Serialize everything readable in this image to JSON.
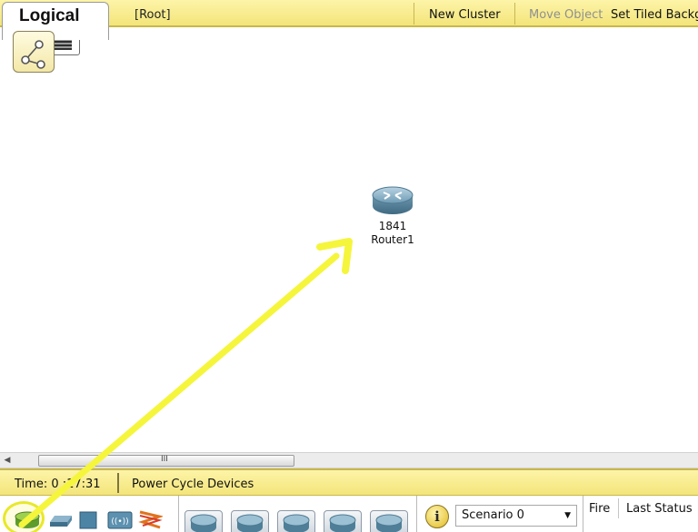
{
  "toolbar": {
    "tab_label": "Logical",
    "path": "[Root]",
    "new_cluster": "New Cluster",
    "move_object": "Move Object",
    "set_tiled_background": "Set Tiled Backg"
  },
  "workspace": {
    "device": {
      "model": "1841",
      "name": "Router1",
      "icon": "router-icon"
    },
    "annotation_color": "#f5f53c"
  },
  "scrollbar": {
    "grip": "III"
  },
  "statusbar": {
    "time": "Time: 0 :17:31",
    "power_cycle": "Power Cycle Devices"
  },
  "bottom_panel": {
    "categories": [
      "routers-icon",
      "switches-icon",
      "hubs-icon",
      "wireless-devices-icon",
      "connections-icon"
    ],
    "device_thumbnails": [
      "router-icon",
      "router-icon",
      "router-icon",
      "router-icon",
      "router-icon"
    ],
    "scenario": "Scenario 0",
    "pdu_columns": [
      "Fire",
      "Last Status"
    ]
  },
  "colors": {
    "toolbar_yellow": "#f3e57a",
    "router_blue": "#5f8fa8",
    "highlight_yellow": "#e8e82a"
  }
}
